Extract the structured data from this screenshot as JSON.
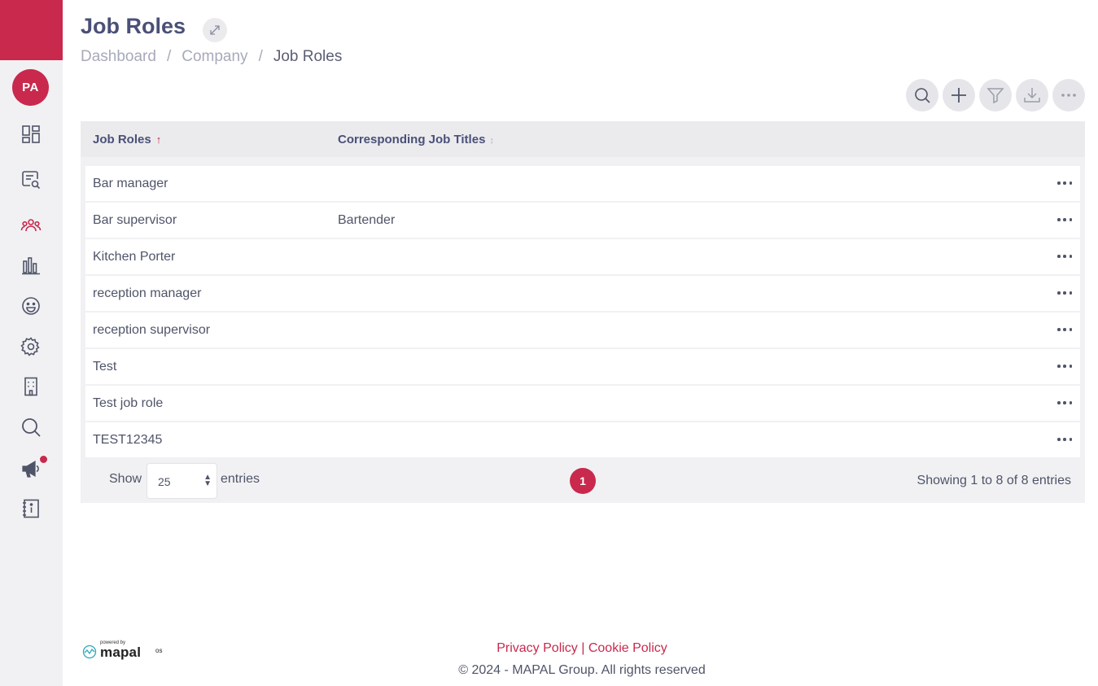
{
  "sidebar": {
    "avatar_initials": "PA",
    "brand_color": "#c8294d",
    "items": [
      {
        "name": "dashboard-icon"
      },
      {
        "name": "search-list-icon"
      },
      {
        "name": "people-icon",
        "active": true
      },
      {
        "name": "bar-chart-icon"
      },
      {
        "name": "smiley-icon"
      },
      {
        "name": "gear-icon"
      },
      {
        "name": "building-icon"
      },
      {
        "name": "search-icon"
      },
      {
        "name": "megaphone-icon",
        "notification": true
      },
      {
        "name": "info-book-icon"
      }
    ]
  },
  "header": {
    "title": "Job Roles",
    "breadcrumb": [
      {
        "label": "Dashboard"
      },
      {
        "label": "Company"
      },
      {
        "label": "Job Roles"
      }
    ]
  },
  "toolbar": {
    "buttons": [
      "search-icon",
      "plus-icon",
      "filter-icon",
      "download-icon",
      "more-icon"
    ]
  },
  "table": {
    "columns": [
      {
        "label": "Job Roles",
        "sort": "asc"
      },
      {
        "label": "Corresponding Job Titles",
        "sort": "none"
      }
    ],
    "rows": [
      {
        "role": "Bar manager",
        "titles": ""
      },
      {
        "role": "Bar supervisor",
        "titles": "Bartender"
      },
      {
        "role": "Kitchen Porter",
        "titles": ""
      },
      {
        "role": "reception manager",
        "titles": ""
      },
      {
        "role": "reception supervisor",
        "titles": ""
      },
      {
        "role": "Test",
        "titles": ""
      },
      {
        "role": "Test job role",
        "titles": ""
      },
      {
        "role": "TEST12345",
        "titles": ""
      }
    ],
    "show_label": "Show",
    "entries_value": "25",
    "entries_label": "entries",
    "current_page": "1",
    "showing_text": "Showing 1 to 8 of 8 entries"
  },
  "footer": {
    "powered_by": "powered by",
    "logo_text": "mapal",
    "logo_suffix": "os",
    "policy_text": "Privacy Policy | Cookie Policy",
    "copyright": "© 2024 - MAPAL Group. All rights reserved"
  }
}
